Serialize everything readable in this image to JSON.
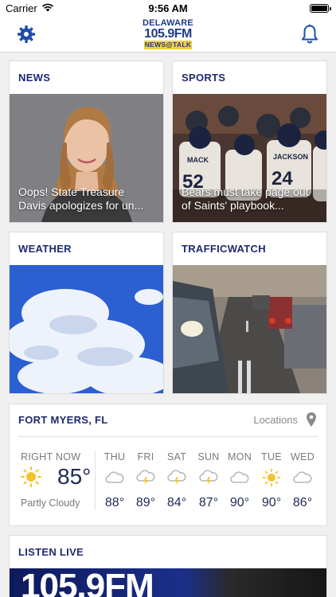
{
  "status": {
    "carrier": "Carrier",
    "time": "9:56 AM"
  },
  "logo": {
    "line1": "DELAWARE",
    "line2": "105.9FM",
    "line3": "NEWS@TALK"
  },
  "tiles": {
    "news": {
      "title": "NEWS",
      "caption": "Oops! State Treasure Davis apologizes for un..."
    },
    "sports": {
      "title": "SPORTS",
      "caption": "Bears must take page out of Saints' playbook..."
    },
    "weather": {
      "title": "WEATHER"
    },
    "traffic": {
      "title": "TRAFFICWATCH"
    }
  },
  "weather": {
    "city": "FORT MYERS, FL",
    "locations_label": "Locations",
    "now": {
      "label": "RIGHT NOW",
      "temp": "85°",
      "condition": "Partly Cloudy",
      "icon": "sun-icon"
    },
    "forecast": [
      {
        "day": "THU",
        "temp": "88°",
        "icon": "cloud-icon"
      },
      {
        "day": "FRI",
        "temp": "89°",
        "icon": "thunder-cloud-icon"
      },
      {
        "day": "SAT",
        "temp": "84°",
        "icon": "thunder-cloud-icon"
      },
      {
        "day": "SUN",
        "temp": "87°",
        "icon": "thunder-cloud-icon"
      },
      {
        "day": "MON",
        "temp": "90°",
        "icon": "cloud-icon"
      },
      {
        "day": "TUE",
        "temp": "90°",
        "icon": "sun-icon"
      },
      {
        "day": "WED",
        "temp": "86°",
        "icon": "cloud-icon"
      }
    ]
  },
  "listen": {
    "title": "LISTEN LIVE",
    "banner_text": "105.9FM"
  },
  "colors": {
    "accent": "#1f4ea8",
    "title": "#1f2a70",
    "sun": "#f2c230"
  }
}
